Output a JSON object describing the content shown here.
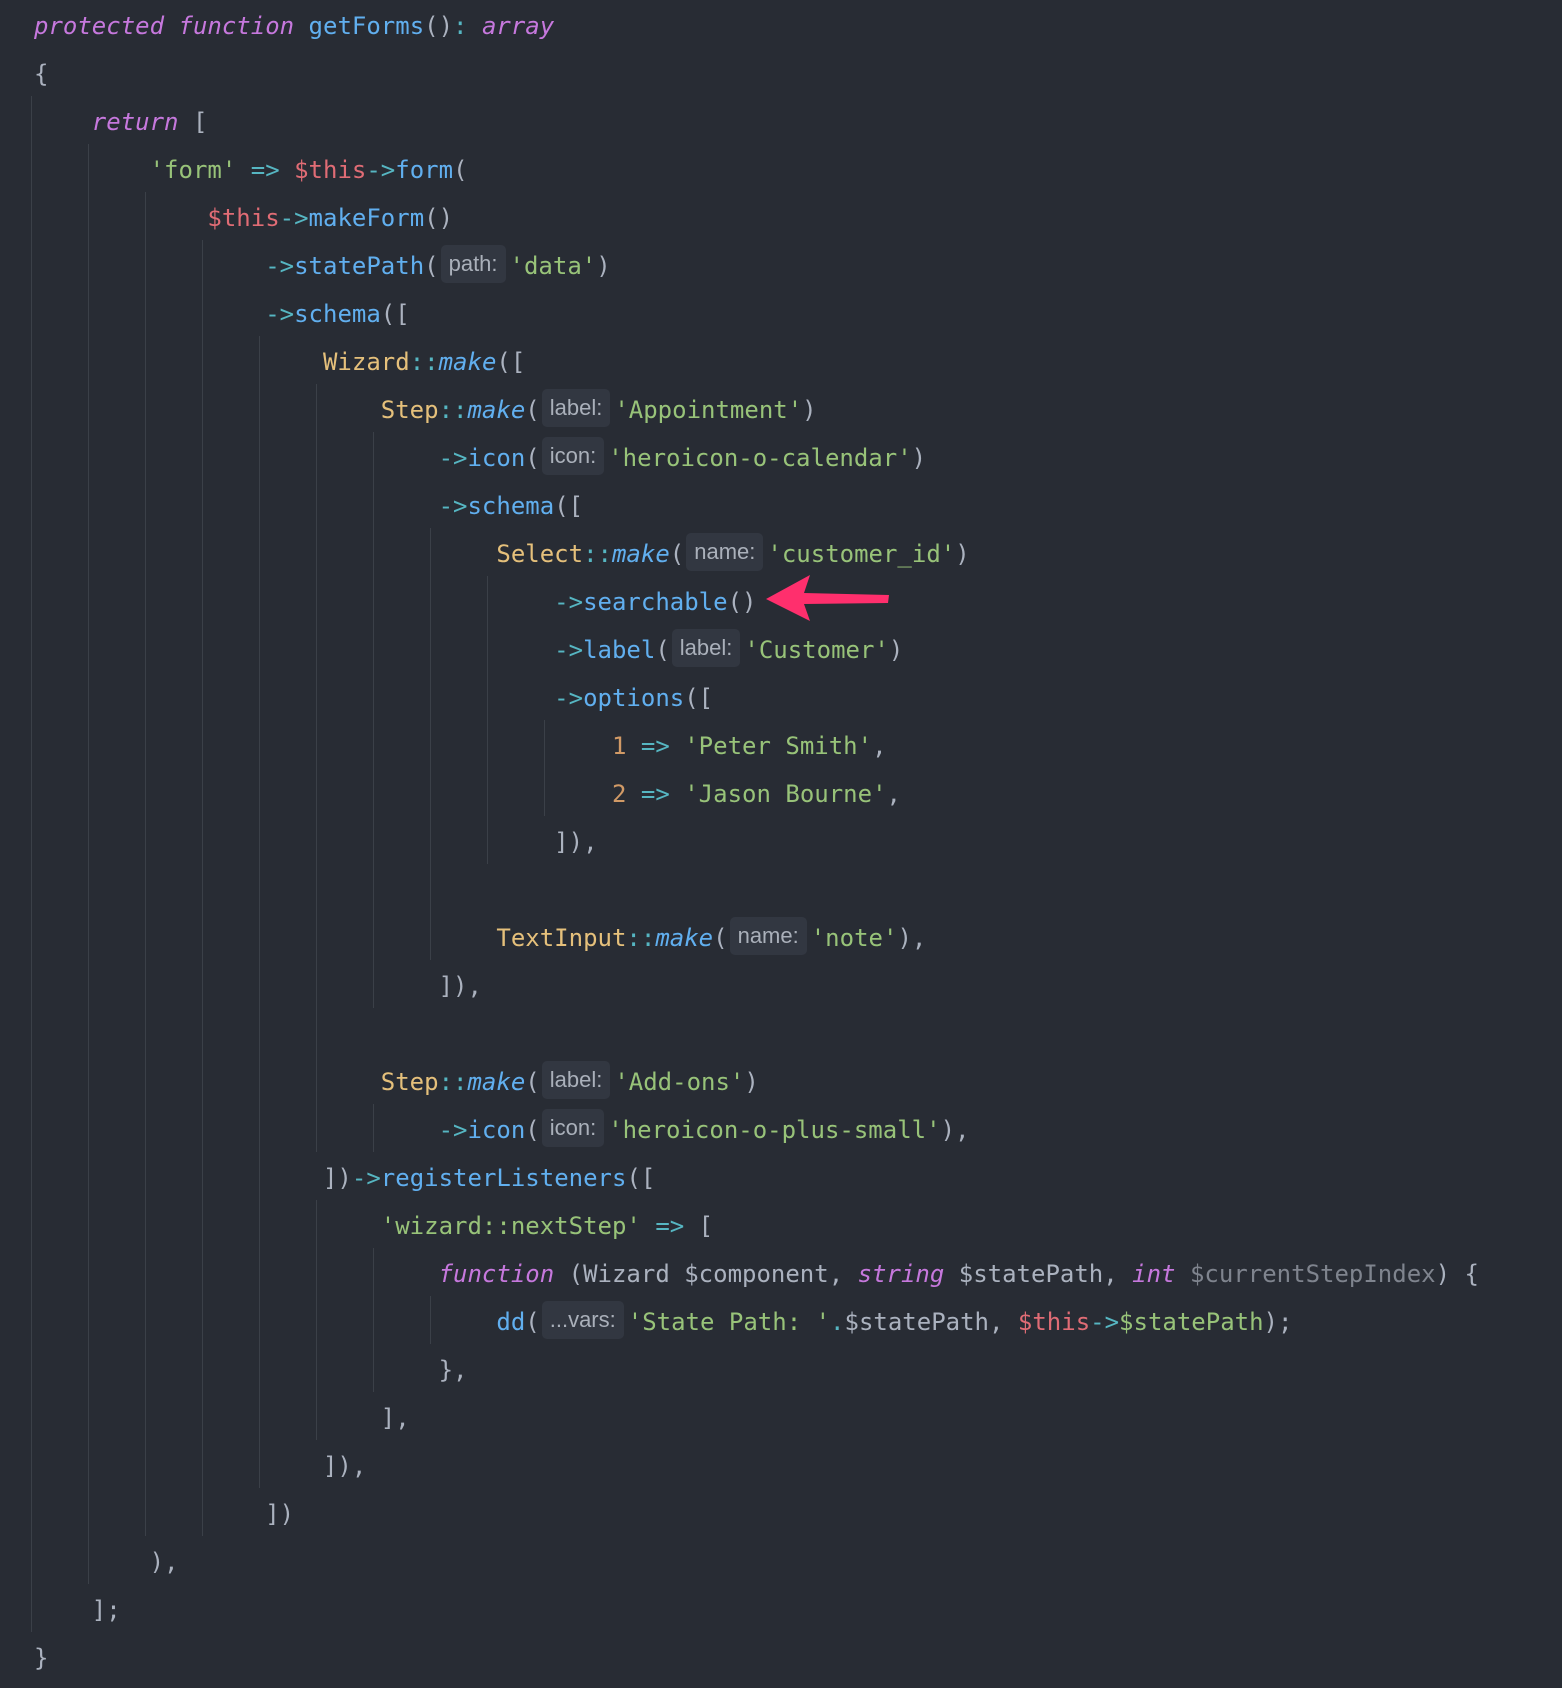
{
  "colors": {
    "background": "#282c34",
    "keyword": "#c678dd",
    "function": "#61afef",
    "operator": "#56b6c2",
    "string": "#98c379",
    "class": "#e5c07b",
    "this": "#e06c75",
    "number": "#d19a66",
    "plain": "#abb2bf",
    "hint_background": "#323741",
    "arrow": "#ff2f6d"
  },
  "annotation": {
    "icon": "arrow-left-icon",
    "points_to": "->searchable()"
  },
  "code": {
    "lines": [
      {
        "tokens": [
          {
            "t": "protected",
            "c": "kw"
          },
          {
            "t": " ",
            "c": "plain"
          },
          {
            "t": "function",
            "c": "kw"
          },
          {
            "t": " ",
            "c": "plain"
          },
          {
            "t": "getForms",
            "c": "fn"
          },
          {
            "t": "()",
            "c": "plain"
          },
          {
            "t": ":",
            "c": "op"
          },
          {
            "t": " ",
            "c": "plain"
          },
          {
            "t": "array",
            "c": "kw"
          }
        ]
      },
      {
        "tokens": [
          {
            "t": "{",
            "c": "plain"
          }
        ]
      },
      {
        "tokens": [
          {
            "t": "    ",
            "c": "plain"
          },
          {
            "t": "return",
            "c": "kw"
          },
          {
            "t": " [",
            "c": "plain"
          }
        ]
      },
      {
        "tokens": [
          {
            "t": "        ",
            "c": "plain"
          },
          {
            "t": "'form'",
            "c": "str"
          },
          {
            "t": " ",
            "c": "plain"
          },
          {
            "t": "=>",
            "c": "op"
          },
          {
            "t": " ",
            "c": "plain"
          },
          {
            "t": "$this",
            "c": "this"
          },
          {
            "t": "->",
            "c": "op"
          },
          {
            "t": "form",
            "c": "fn"
          },
          {
            "t": "(",
            "c": "plain"
          }
        ]
      },
      {
        "tokens": [
          {
            "t": "            ",
            "c": "plain"
          },
          {
            "t": "$this",
            "c": "this"
          },
          {
            "t": "->",
            "c": "op"
          },
          {
            "t": "makeForm",
            "c": "fn"
          },
          {
            "t": "()",
            "c": "plain"
          }
        ]
      },
      {
        "tokens": [
          {
            "t": "                ",
            "c": "plain"
          },
          {
            "t": "->",
            "c": "op"
          },
          {
            "t": "statePath",
            "c": "fn"
          },
          {
            "t": "(",
            "c": "plain"
          },
          {
            "t": "path:",
            "c": "hint"
          },
          {
            "t": "'data'",
            "c": "str"
          },
          {
            "t": ")",
            "c": "plain"
          }
        ]
      },
      {
        "tokens": [
          {
            "t": "                ",
            "c": "plain"
          },
          {
            "t": "->",
            "c": "op"
          },
          {
            "t": "schema",
            "c": "fn"
          },
          {
            "t": "([",
            "c": "plain"
          }
        ]
      },
      {
        "tokens": [
          {
            "t": "                    ",
            "c": "plain"
          },
          {
            "t": "Wizard",
            "c": "cls"
          },
          {
            "t": "::",
            "c": "op"
          },
          {
            "t": "make",
            "c": "static"
          },
          {
            "t": "([",
            "c": "plain"
          }
        ]
      },
      {
        "tokens": [
          {
            "t": "                        ",
            "c": "plain"
          },
          {
            "t": "Step",
            "c": "cls"
          },
          {
            "t": "::",
            "c": "op"
          },
          {
            "t": "make",
            "c": "static"
          },
          {
            "t": "(",
            "c": "plain"
          },
          {
            "t": "label:",
            "c": "hint"
          },
          {
            "t": "'Appointment'",
            "c": "str"
          },
          {
            "t": ")",
            "c": "plain"
          }
        ]
      },
      {
        "tokens": [
          {
            "t": "                            ",
            "c": "plain"
          },
          {
            "t": "->",
            "c": "op"
          },
          {
            "t": "icon",
            "c": "fn"
          },
          {
            "t": "(",
            "c": "plain"
          },
          {
            "t": "icon:",
            "c": "hint"
          },
          {
            "t": "'heroicon-o-calendar'",
            "c": "str"
          },
          {
            "t": ")",
            "c": "plain"
          }
        ]
      },
      {
        "tokens": [
          {
            "t": "                            ",
            "c": "plain"
          },
          {
            "t": "->",
            "c": "op"
          },
          {
            "t": "schema",
            "c": "fn"
          },
          {
            "t": "([",
            "c": "plain"
          }
        ]
      },
      {
        "tokens": [
          {
            "t": "                                ",
            "c": "plain"
          },
          {
            "t": "Select",
            "c": "cls"
          },
          {
            "t": "::",
            "c": "op"
          },
          {
            "t": "make",
            "c": "static"
          },
          {
            "t": "(",
            "c": "plain"
          },
          {
            "t": "name:",
            "c": "hint"
          },
          {
            "t": "'customer_id'",
            "c": "str"
          },
          {
            "t": ")",
            "c": "plain"
          }
        ]
      },
      {
        "tokens": [
          {
            "t": "                                    ",
            "c": "plain"
          },
          {
            "t": "->",
            "c": "op"
          },
          {
            "t": "searchable",
            "c": "fn"
          },
          {
            "t": "()",
            "c": "plain"
          }
        ]
      },
      {
        "tokens": [
          {
            "t": "                                    ",
            "c": "plain"
          },
          {
            "t": "->",
            "c": "op"
          },
          {
            "t": "label",
            "c": "fn"
          },
          {
            "t": "(",
            "c": "plain"
          },
          {
            "t": "label:",
            "c": "hint"
          },
          {
            "t": "'Customer'",
            "c": "str"
          },
          {
            "t": ")",
            "c": "plain"
          }
        ]
      },
      {
        "tokens": [
          {
            "t": "                                    ",
            "c": "plain"
          },
          {
            "t": "->",
            "c": "op"
          },
          {
            "t": "options",
            "c": "fn"
          },
          {
            "t": "([",
            "c": "plain"
          }
        ]
      },
      {
        "tokens": [
          {
            "t": "                                        ",
            "c": "plain"
          },
          {
            "t": "1",
            "c": "num"
          },
          {
            "t": " ",
            "c": "plain"
          },
          {
            "t": "=>",
            "c": "op"
          },
          {
            "t": " ",
            "c": "plain"
          },
          {
            "t": "'Peter Smith'",
            "c": "str"
          },
          {
            "t": ",",
            "c": "plain"
          }
        ]
      },
      {
        "tokens": [
          {
            "t": "                                        ",
            "c": "plain"
          },
          {
            "t": "2",
            "c": "num"
          },
          {
            "t": " ",
            "c": "plain"
          },
          {
            "t": "=>",
            "c": "op"
          },
          {
            "t": " ",
            "c": "plain"
          },
          {
            "t": "'Jason Bourne'",
            "c": "str"
          },
          {
            "t": ",",
            "c": "plain"
          }
        ]
      },
      {
        "tokens": [
          {
            "t": "                                    ",
            "c": "plain"
          },
          {
            "t": "]),",
            "c": "plain"
          }
        ]
      },
      {
        "tokens": []
      },
      {
        "tokens": [
          {
            "t": "                                ",
            "c": "plain"
          },
          {
            "t": "TextInput",
            "c": "cls"
          },
          {
            "t": "::",
            "c": "op"
          },
          {
            "t": "make",
            "c": "static"
          },
          {
            "t": "(",
            "c": "plain"
          },
          {
            "t": "name:",
            "c": "hint"
          },
          {
            "t": "'note'",
            "c": "str"
          },
          {
            "t": "),",
            "c": "plain"
          }
        ]
      },
      {
        "tokens": [
          {
            "t": "                            ",
            "c": "plain"
          },
          {
            "t": "]),",
            "c": "plain"
          }
        ]
      },
      {
        "tokens": []
      },
      {
        "tokens": [
          {
            "t": "                        ",
            "c": "plain"
          },
          {
            "t": "Step",
            "c": "cls"
          },
          {
            "t": "::",
            "c": "op"
          },
          {
            "t": "make",
            "c": "static"
          },
          {
            "t": "(",
            "c": "plain"
          },
          {
            "t": "label:",
            "c": "hint"
          },
          {
            "t": "'Add-ons'",
            "c": "str"
          },
          {
            "t": ")",
            "c": "plain"
          }
        ]
      },
      {
        "tokens": [
          {
            "t": "                            ",
            "c": "plain"
          },
          {
            "t": "->",
            "c": "op"
          },
          {
            "t": "icon",
            "c": "fn"
          },
          {
            "t": "(",
            "c": "plain"
          },
          {
            "t": "icon:",
            "c": "hint"
          },
          {
            "t": "'heroicon-o-plus-small'",
            "c": "str"
          },
          {
            "t": "),",
            "c": "plain"
          }
        ]
      },
      {
        "tokens": [
          {
            "t": "                    ",
            "c": "plain"
          },
          {
            "t": "])",
            "c": "plain"
          },
          {
            "t": "->",
            "c": "op"
          },
          {
            "t": "registerListeners",
            "c": "fn"
          },
          {
            "t": "([",
            "c": "plain"
          }
        ]
      },
      {
        "tokens": [
          {
            "t": "                        ",
            "c": "plain"
          },
          {
            "t": "'wizard::nextStep'",
            "c": "str"
          },
          {
            "t": " ",
            "c": "plain"
          },
          {
            "t": "=>",
            "c": "op"
          },
          {
            "t": " [",
            "c": "plain"
          }
        ]
      },
      {
        "tokens": [
          {
            "t": "                            ",
            "c": "plain"
          },
          {
            "t": "function",
            "c": "kw"
          },
          {
            "t": " (Wizard $component, ",
            "c": "plain"
          },
          {
            "t": "string",
            "c": "kw"
          },
          {
            "t": " $statePath, ",
            "c": "plain"
          },
          {
            "t": "int",
            "c": "kw"
          },
          {
            "t": " ",
            "c": "plain"
          },
          {
            "t": "$currentStepIndex",
            "c": "muted"
          },
          {
            "t": ") {",
            "c": "plain"
          }
        ]
      },
      {
        "tokens": [
          {
            "t": "                                ",
            "c": "plain"
          },
          {
            "t": "dd",
            "c": "fn"
          },
          {
            "t": "(",
            "c": "plain"
          },
          {
            "t": "...vars:",
            "c": "hint"
          },
          {
            "t": "'State Path: '",
            "c": "str"
          },
          {
            "t": ".",
            "c": "op"
          },
          {
            "t": "$statePath, ",
            "c": "plain"
          },
          {
            "t": "$this",
            "c": "this"
          },
          {
            "t": "->",
            "c": "op"
          },
          {
            "t": "$statePath",
            "c": "str"
          },
          {
            "t": ");",
            "c": "plain"
          }
        ]
      },
      {
        "tokens": [
          {
            "t": "                            ",
            "c": "plain"
          },
          {
            "t": "},",
            "c": "plain"
          }
        ]
      },
      {
        "tokens": [
          {
            "t": "                        ",
            "c": "plain"
          },
          {
            "t": "],",
            "c": "plain"
          }
        ]
      },
      {
        "tokens": [
          {
            "t": "                    ",
            "c": "plain"
          },
          {
            "t": "]),",
            "c": "plain"
          }
        ]
      },
      {
        "tokens": [
          {
            "t": "                ",
            "c": "plain"
          },
          {
            "t": "])",
            "c": "plain"
          }
        ]
      },
      {
        "tokens": [
          {
            "t": "        ",
            "c": "plain"
          },
          {
            "t": "),",
            "c": "plain"
          }
        ]
      },
      {
        "tokens": [
          {
            "t": "    ",
            "c": "plain"
          },
          {
            "t": "];",
            "c": "plain"
          }
        ]
      },
      {
        "tokens": [
          {
            "t": "}",
            "c": "plain"
          }
        ]
      }
    ]
  }
}
